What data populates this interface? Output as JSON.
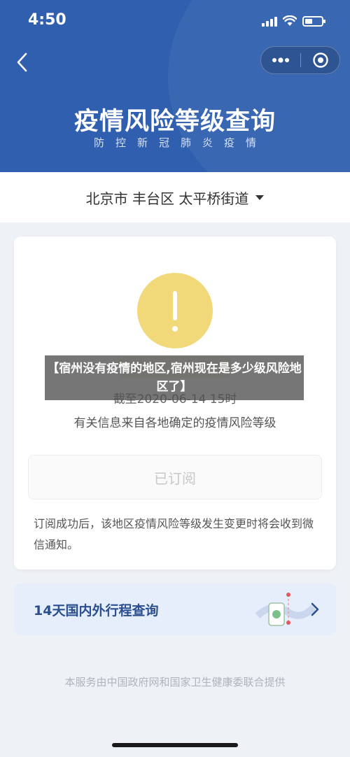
{
  "status_bar": {
    "time": "4:50"
  },
  "header": {
    "title": "疫情风险等级查询",
    "subtitle": "防控新冠肺炎疫情",
    "back_icon": "chevron-left-icon",
    "more_icon": "more-dots-icon",
    "close_icon": "target-close-icon",
    "background_color": "#2f5fae"
  },
  "location": {
    "text": "北京市 丰台区 太平桥街道",
    "caret_icon": "caret-down-icon"
  },
  "risk_card": {
    "warning_icon": "exclamation-circle-icon",
    "warning_color": "#f1d97a",
    "date_text": "截至2020-06-14 15时",
    "info_text": "有关信息来自各地确定的疫情风险等级",
    "subscribe_label": "已订阅",
    "notice_text": "订阅成功后，该地区疫情风险等级发生变更时将会收到微信通知。"
  },
  "itinerary": {
    "label": "14天国内外行程查询",
    "arrow_icon": "chevron-right-icon"
  },
  "footer": {
    "text": "本服务由中国政府网和国家卫生健康委联合提供"
  },
  "overlay": {
    "caption": "【宿州没有疫情的地区,宿州现在是多少级风险地区了】"
  }
}
